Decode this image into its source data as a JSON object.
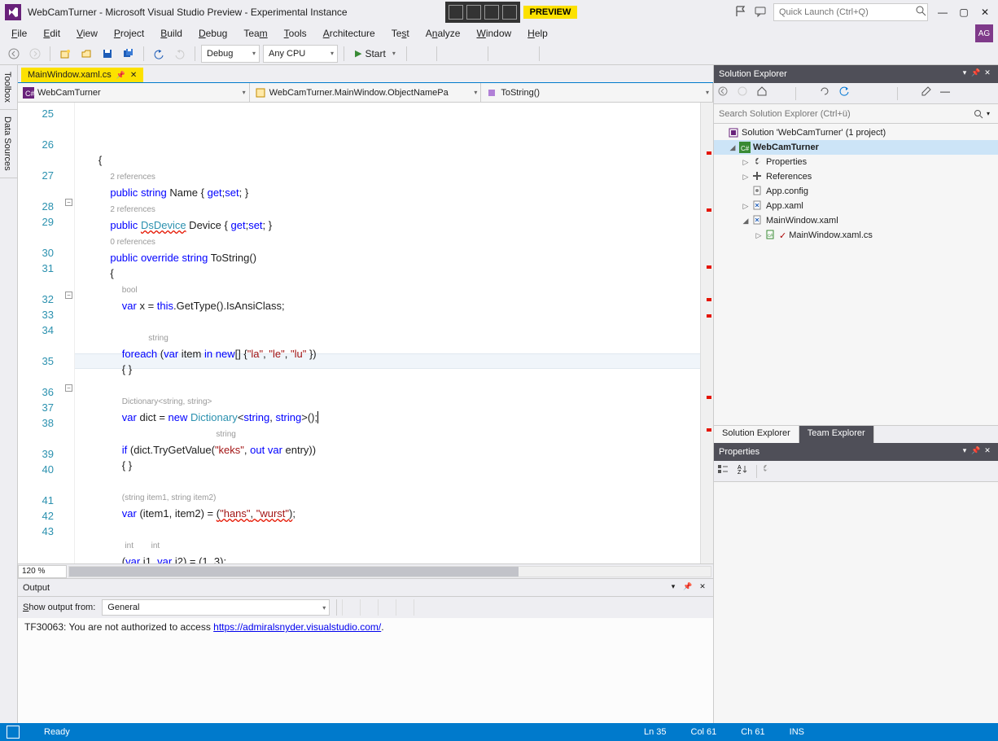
{
  "title": "WebCamTurner - Microsoft Visual Studio Preview - Experimental Instance",
  "preview_badge": "PREVIEW",
  "quicklaunch_placeholder": "Quick Launch (Ctrl+Q)",
  "user_initials": "AG",
  "menu": [
    "File",
    "Edit",
    "View",
    "Project",
    "Build",
    "Debug",
    "Team",
    "Tools",
    "Architecture",
    "Test",
    "Analyze",
    "Window",
    "Help"
  ],
  "toolbar": {
    "config": "Debug",
    "platform": "Any CPU",
    "start": "Start"
  },
  "left_tabs": [
    "Toolbox",
    "Data Sources"
  ],
  "doc_tab": "MainWindow.xaml.cs",
  "nav": {
    "ns": "WebCamTurner",
    "class": "WebCamTurner.MainWindow.ObjectNamePa",
    "member": "ToString()"
  },
  "zoom": "120 %",
  "line_numbers": [
    25,
    26,
    27,
    28,
    29,
    30,
    31,
    32,
    33,
    34,
    35,
    36,
    37,
    38,
    39,
    40,
    41,
    42,
    43
  ],
  "code": {
    "l25": "        {",
    "ref_2a": "2 references",
    "ref_2b": "2 references",
    "ref_0": "0 references",
    "hint_bool": "bool",
    "hint_string": "string",
    "hint_string2": "string",
    "hint_dict": "Dictionary<string, string>",
    "hint_tuple": "(string item1, string item2)",
    "hint_int1": "int",
    "hint_int2": "int"
  },
  "output": {
    "title": "Output",
    "show_label": "Show output from:",
    "source": "General",
    "line_prefix": "TF30063: You are not authorized to access ",
    "link": "https://admiralsnyder.visualstudio.com/",
    "line_suffix": "."
  },
  "solution_explorer": {
    "title": "Solution Explorer",
    "search_placeholder": "Search Solution Explorer (Ctrl+ü)",
    "solution": "Solution 'WebCamTurner' (1 project)",
    "project": "WebCamTurner",
    "items": [
      "Properties",
      "References",
      "App.config",
      "App.xaml",
      "MainWindow.xaml",
      "MainWindow.xaml.cs"
    ],
    "tabs": [
      "Solution Explorer",
      "Team Explorer"
    ]
  },
  "properties": {
    "title": "Properties"
  },
  "status": {
    "ready": "Ready",
    "ln": "Ln 35",
    "col": "Col 61",
    "ch": "Ch 61",
    "ins": "INS"
  }
}
